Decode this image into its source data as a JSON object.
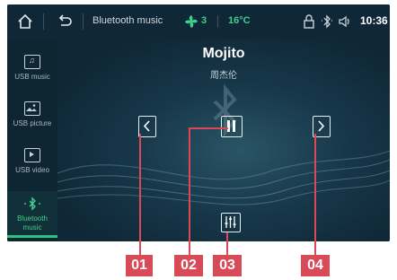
{
  "statusbar": {
    "title": "Bluetooth music",
    "fan_level": "3",
    "temperature": "16°C",
    "time": "10:36"
  },
  "sidebar": {
    "items": [
      {
        "label": "USB music",
        "icon": "music-file-icon"
      },
      {
        "label": "USB picture",
        "icon": "picture-file-icon"
      },
      {
        "label": "USB video",
        "icon": "video-file-icon"
      },
      {
        "label": "Bluetooth music",
        "icon": "bluetooth-icon",
        "active": true
      }
    ]
  },
  "player": {
    "song_title": "Mojito",
    "artist": "周杰伦"
  },
  "callouts": [
    "01",
    "02",
    "03",
    "04"
  ],
  "colors": {
    "accent_green": "#3fd08a",
    "callout_red": "#d84a57",
    "background": "#0f2736"
  }
}
